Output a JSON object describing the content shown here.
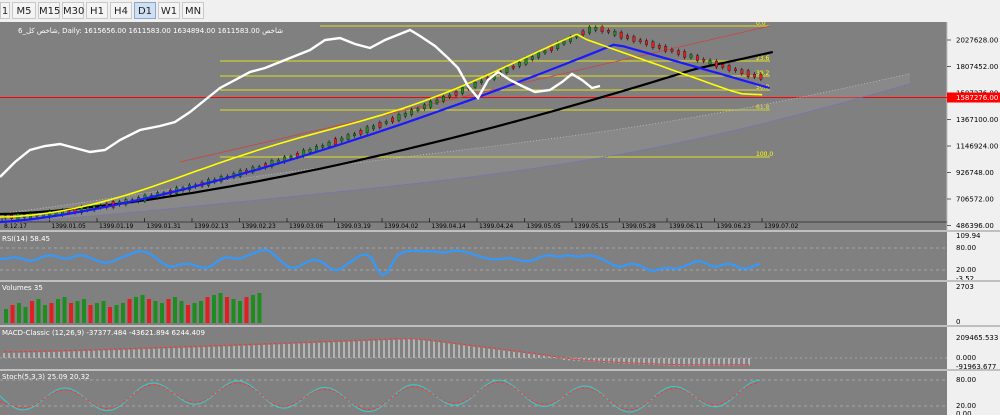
{
  "toolbar": {
    "timeframes": [
      "1",
      "M5",
      "M15",
      "M30",
      "H1",
      "H4",
      "D1",
      "W1",
      "MN"
    ],
    "active": "D1"
  },
  "main_chart": {
    "header": "6_شاخص کل, Daily: 1615656.00 1611583.00 1634894.00 1611583.00 شاخص",
    "price_ticks": [
      "2027628.00",
      "1807452.00",
      "1587276.00",
      "1367100.00",
      "1146924.00",
      "926748.00",
      "706572.00",
      "486396.00"
    ],
    "current_price": "1587276.00",
    "date_ticks": [
      "8.12.17",
      "1399.01.05",
      "1399.01.19",
      "1399.01.31",
      "1399.02.13",
      "1399.02.23",
      "1399.03.06",
      "1399.03.19",
      "1399.04.02",
      "1399.04.14",
      "1399.04.24",
      "1399.05.05",
      "1399.05.15",
      "1399.05.28",
      "1399.06.11",
      "1399.06.23",
      "1399.07.02"
    ],
    "fib_levels": [
      "0.0",
      "23.6",
      "38.2",
      "50.0",
      "61.8",
      "100.0"
    ]
  },
  "rsi": {
    "label": "RSI(14) 58.45",
    "ticks": [
      "109.94",
      "80.00",
      "20.00",
      "-3.52"
    ]
  },
  "volumes": {
    "label": "Volumes 35",
    "ticks": [
      "2703",
      "0"
    ]
  },
  "macd": {
    "label": "MACD-Classic (12,26,9) -37377.484 -43621.894 6244.409",
    "ticks": [
      "209465.533",
      "0.000",
      "-91963.677"
    ]
  },
  "stoch": {
    "label": "Stoch(5,3,3) 25.09 20.32",
    "ticks": [
      "80.00",
      "20.00",
      "0.00"
    ]
  },
  "colors": {
    "background": "#808080",
    "up_candle": "#1e8c1e",
    "down_candle": "#e02020",
    "fib": "#ffff00",
    "price_line": "#ff0000",
    "ma_fast": "#ffff00",
    "ma_mid": "#1a1aff",
    "ma_slow": "#000000",
    "close_line": "#ffffff",
    "rsi_line": "#3399ff",
    "macd_signal": "#ff3333",
    "stoch_main": "#33cccc",
    "stoch_signal": "#ff3333"
  }
}
